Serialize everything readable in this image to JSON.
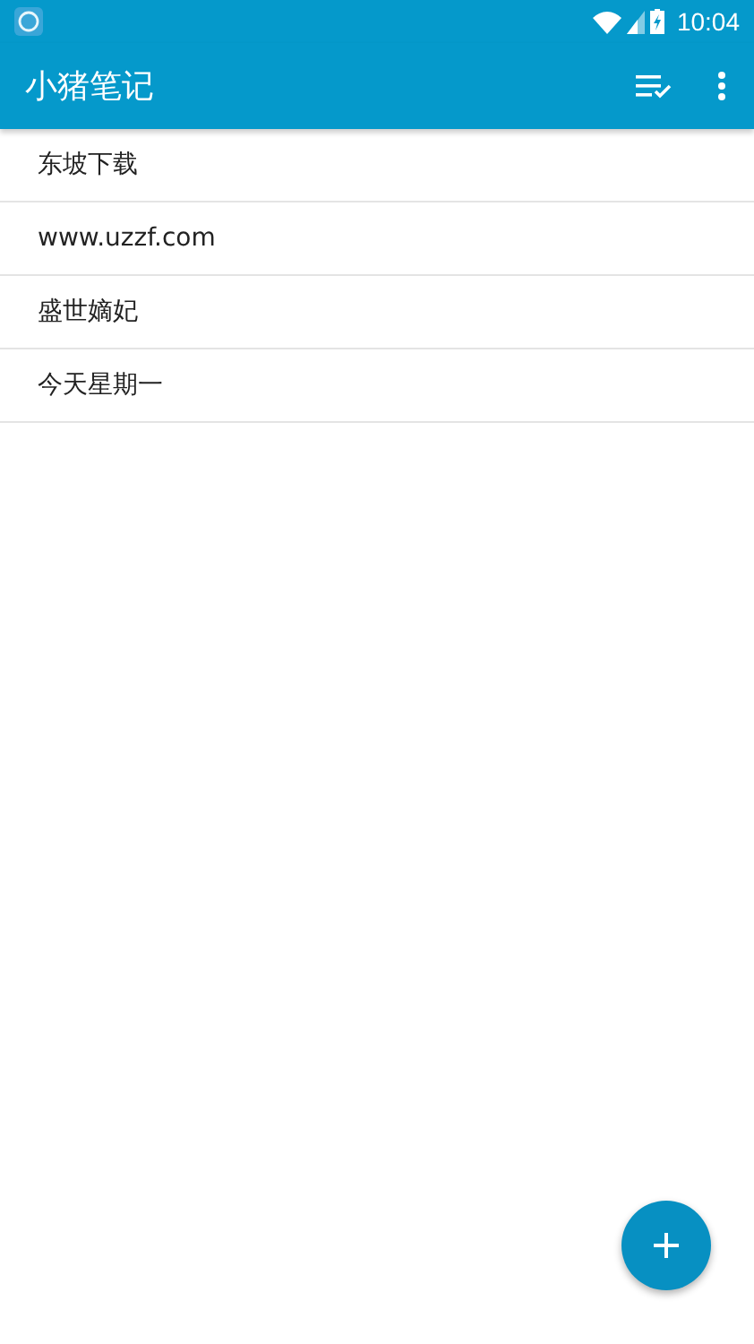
{
  "status_bar": {
    "time": "10:04"
  },
  "toolbar": {
    "title": "小猪笔记"
  },
  "notes": [
    {
      "title": "东坡下载"
    },
    {
      "title": "www.uzzf.com"
    },
    {
      "title": "盛世嫡妃"
    },
    {
      "title": "今天星期一"
    }
  ]
}
